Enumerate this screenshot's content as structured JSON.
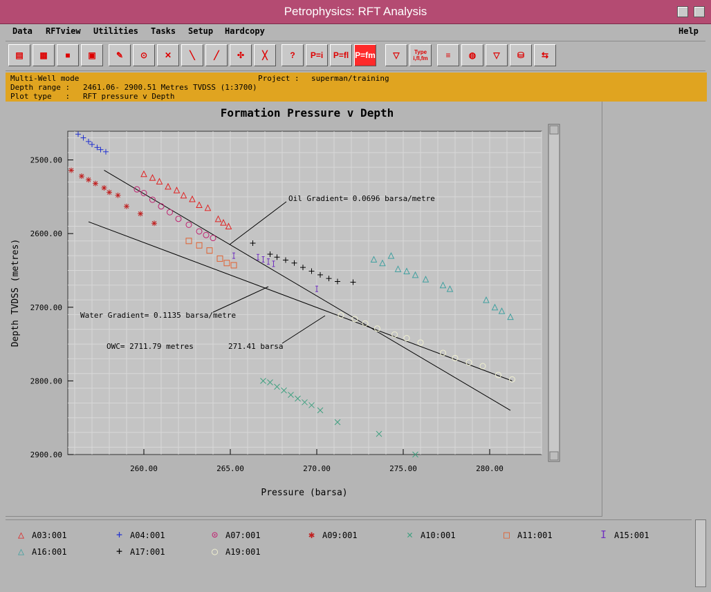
{
  "window": {
    "title": "Petrophysics: RFT Analysis"
  },
  "menu": {
    "items": [
      "Data",
      "RFTview",
      "Utilities",
      "Tasks",
      "Setup",
      "Hardcopy"
    ],
    "help": "Help"
  },
  "toolbar": {
    "p_eq_i": "P=i",
    "p_eq_fl": "P=fl",
    "p_eq_fm": "P=fm",
    "type_label": "Type i,fl,fm"
  },
  "info": {
    "mode": "Multi-Well mode",
    "project_label": "Project :",
    "project_value": "superman/training",
    "depth_label": "Depth range :",
    "depth_value": "2461.06- 2900.51 Metres TVDSS (1:3700)",
    "plot_type_label": "Plot type   :",
    "plot_type_value": "RFT pressure v Depth"
  },
  "chart_data": {
    "type": "scatter",
    "title": "Formation Pressure v Depth",
    "xlabel": "Pressure (barsa)",
    "ylabel": "Depth TVDSS (metres)",
    "xlim": [
      255.6,
      283.0
    ],
    "ylim": [
      2900,
      2461.06
    ],
    "xticks": [
      260,
      265,
      270,
      275,
      280
    ],
    "xtick_labels": [
      "260.00",
      "265.00",
      "270.00",
      "275.00",
      "280.00"
    ],
    "yticks": [
      2500,
      2600,
      2700,
      2800,
      2900
    ],
    "ytick_labels": [
      "2500.00",
      "2600.00",
      "2700.00",
      "2800.00",
      "2900.00"
    ],
    "grid": true,
    "annotations": {
      "oil_gradient": "Oil Gradient= 0.0696 barsa/metre",
      "water_gradient": "Water Gradient= 0.1135 barsa/metre",
      "owc": "OWC= 2711.79 metres",
      "owc_pressure": "271.41 barsa"
    },
    "lines": [
      {
        "name": "oil",
        "x": [
          257.7,
          281.2
        ],
        "y": [
          2514,
          2840
        ]
      },
      {
        "name": "water",
        "x": [
          256.8,
          281.3
        ],
        "y": [
          2584,
          2800
        ]
      }
    ],
    "series": [
      {
        "name": "A03:001",
        "symbol": "triangle",
        "color": "#e02020",
        "x": [
          260.0,
          260.5,
          260.9,
          261.4,
          261.9,
          262.3,
          262.8,
          263.2,
          263.7,
          264.3,
          264.6,
          264.9
        ],
        "y": [
          2519,
          2524,
          2529,
          2536,
          2541,
          2548,
          2553,
          2561,
          2565,
          2580,
          2585,
          2590
        ]
      },
      {
        "name": "A04:001",
        "symbol": "plus",
        "color": "#2030d0",
        "x": [
          256.2,
          256.5,
          256.8,
          257.0,
          257.3,
          257.5,
          257.8
        ],
        "y": [
          2465,
          2470,
          2475,
          2479,
          2483,
          2486,
          2489
        ]
      },
      {
        "name": "A07:001",
        "symbol": "circle-dot",
        "color": "#c02070",
        "x": [
          259.6,
          260.0,
          260.5,
          261.0,
          261.5,
          262.0,
          262.6,
          263.2,
          263.6,
          264.0
        ],
        "y": [
          2540,
          2545,
          2554,
          2563,
          2571,
          2580,
          2588,
          2597,
          2602,
          2606
        ]
      },
      {
        "name": "A09:001",
        "symbol": "asterisk",
        "color": "#c02020",
        "x": [
          255.8,
          256.4,
          256.8,
          257.2,
          257.7,
          258.0,
          258.5,
          259.0,
          259.8,
          260.6
        ],
        "y": [
          2514,
          2522,
          2527,
          2532,
          2538,
          2544,
          2548,
          2563,
          2573,
          2586
        ]
      },
      {
        "name": "A10:001",
        "symbol": "x",
        "color": "#40a080",
        "x": [
          266.9,
          267.3,
          267.7,
          268.1,
          268.5,
          268.9,
          269.3,
          269.7,
          270.2,
          271.2,
          273.6,
          275.7
        ],
        "y": [
          2800,
          2802,
          2808,
          2813,
          2819,
          2824,
          2829,
          2833,
          2840,
          2856,
          2872,
          2900
        ]
      },
      {
        "name": "A11:001",
        "symbol": "square",
        "color": "#e06030",
        "x": [
          262.6,
          263.2,
          263.8,
          264.4,
          264.8,
          265.2
        ],
        "y": [
          2610,
          2616,
          2623,
          2634,
          2640,
          2643
        ]
      },
      {
        "name": "A15:001",
        "symbol": "ibeam",
        "color": "#7030c0",
        "x": [
          265.2,
          266.6,
          266.9,
          267.2,
          267.5,
          270.0
        ],
        "y": [
          2630,
          2632,
          2635,
          2638,
          2641,
          2675
        ]
      },
      {
        "name": "A16:001",
        "symbol": "triangle",
        "color": "#40a0a0",
        "x": [
          273.3,
          273.8,
          274.3,
          274.7,
          275.2,
          275.7,
          276.3,
          277.3,
          277.7,
          279.8,
          280.3,
          280.7,
          281.2
        ],
        "y": [
          2635,
          2640,
          2630,
          2648,
          2651,
          2656,
          2662,
          2670,
          2675,
          2690,
          2700,
          2705,
          2713
        ]
      },
      {
        "name": "A17:001",
        "symbol": "plus",
        "color": "#000000",
        "x": [
          266.3,
          267.3,
          267.7,
          268.2,
          268.7,
          269.2,
          269.7,
          270.2,
          270.7,
          271.2,
          272.1
        ],
        "y": [
          2613,
          2628,
          2632,
          2636,
          2640,
          2646,
          2651,
          2656,
          2661,
          2665,
          2666
        ]
      },
      {
        "name": "A19:001",
        "symbol": "circle",
        "color": "#f0f0d0",
        "x": [
          271.4,
          272.2,
          272.8,
          273.5,
          274.5,
          275.2,
          276.0,
          277.3,
          278.0,
          278.8,
          279.6,
          280.5,
          281.3
        ],
        "y": [
          2711,
          2716,
          2722,
          2729,
          2737,
          2742,
          2748,
          2762,
          2769,
          2775,
          2780,
          2792,
          2798
        ]
      }
    ]
  }
}
